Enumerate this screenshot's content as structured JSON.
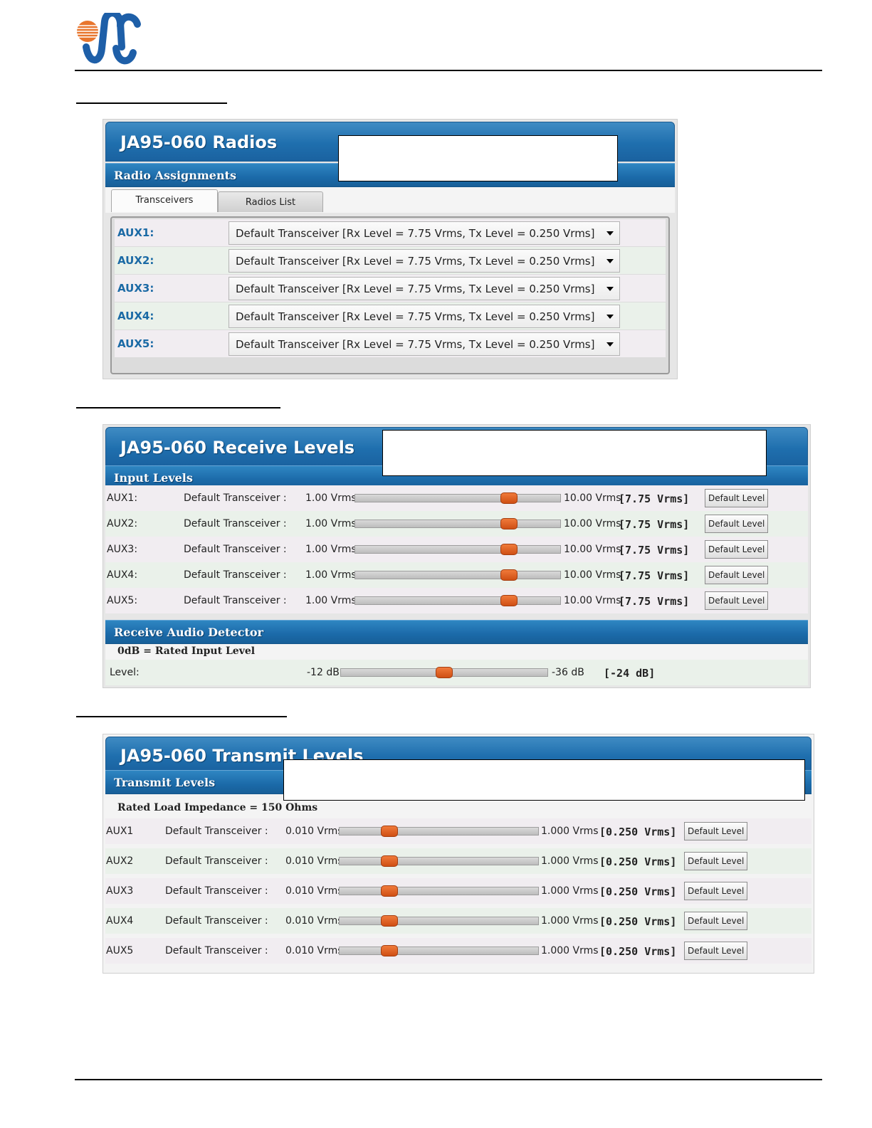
{
  "radios_panel": {
    "title": "JA95-060 Radios",
    "subtitle": "Radio Assignments",
    "tabs": [
      {
        "label": "Transceivers",
        "active": true
      },
      {
        "label": "Radios List",
        "active": false
      }
    ],
    "rows": [
      {
        "label": "AUX1:",
        "value": "Default Transceiver  [Rx Level = 7.75 Vrms,  Tx Level = 0.250 Vrms]"
      },
      {
        "label": "AUX2:",
        "value": "Default Transceiver  [Rx Level = 7.75 Vrms,  Tx Level = 0.250 Vrms]"
      },
      {
        "label": "AUX3:",
        "value": "Default Transceiver  [Rx Level = 7.75 Vrms,  Tx Level = 0.250 Vrms]"
      },
      {
        "label": "AUX4:",
        "value": "Default Transceiver  [Rx Level = 7.75 Vrms,  Tx Level = 0.250 Vrms]"
      },
      {
        "label": "AUX5:",
        "value": "Default Transceiver  [Rx Level = 7.75 Vrms,  Tx Level = 0.250 Vrms]"
      }
    ]
  },
  "receive_panel": {
    "title": "JA95-060 Receive Levels",
    "input_header": "Input Levels",
    "rows": [
      {
        "aux": "AUX1:",
        "radio": "Default Transceiver :",
        "min": "1.00 Vrms",
        "max": "10.00 Vrms",
        "current": "[7.75 Vrms]",
        "level": 0.75,
        "button": "Default Level"
      },
      {
        "aux": "AUX2:",
        "radio": "Default Transceiver :",
        "min": "1.00 Vrms",
        "max": "10.00 Vrms",
        "current": "[7.75 Vrms]",
        "level": 0.75,
        "button": "Default Level"
      },
      {
        "aux": "AUX3:",
        "radio": "Default Transceiver :",
        "min": "1.00 Vrms",
        "max": "10.00 Vrms",
        "current": "[7.75 Vrms]",
        "level": 0.75,
        "button": "Default Level"
      },
      {
        "aux": "AUX4:",
        "radio": "Default Transceiver :",
        "min": "1.00 Vrms",
        "max": "10.00 Vrms",
        "current": "[7.75 Vrms]",
        "level": 0.75,
        "button": "Default Level"
      },
      {
        "aux": "AUX5:",
        "radio": "Default Transceiver :",
        "min": "1.00 Vrms",
        "max": "10.00 Vrms",
        "current": "[7.75 Vrms]",
        "level": 0.75,
        "button": "Default Level"
      }
    ],
    "detector_header": "Receive Audio Detector",
    "detector_note": "0dB = Rated Input Level",
    "detector": {
      "label": "Level:",
      "min": "-12 dB",
      "max": "-36 dB",
      "current": "[-24 dB]",
      "level": 0.5
    }
  },
  "transmit_panel": {
    "title": "JA95-060 Transmit Levels",
    "header": "Transmit Levels",
    "note": "Rated Load Impedance = 150 Ohms",
    "rows": [
      {
        "aux": "AUX1",
        "radio": "Default Transceiver :",
        "min": "0.010 Vrms",
        "max": "1.000 Vrms",
        "current": "[0.250 Vrms]",
        "level": 0.25,
        "button": "Default Level"
      },
      {
        "aux": "AUX2",
        "radio": "Default Transceiver :",
        "min": "0.010 Vrms",
        "max": "1.000 Vrms",
        "current": "[0.250 Vrms]",
        "level": 0.25,
        "button": "Default Level"
      },
      {
        "aux": "AUX3",
        "radio": "Default Transceiver :",
        "min": "0.010 Vrms",
        "max": "1.000 Vrms",
        "current": "[0.250 Vrms]",
        "level": 0.25,
        "button": "Default Level"
      },
      {
        "aux": "AUX4",
        "radio": "Default Transceiver :",
        "min": "0.010 Vrms",
        "max": "1.000 Vrms",
        "current": "[0.250 Vrms]",
        "level": 0.25,
        "button": "Default Level"
      },
      {
        "aux": "AUX5",
        "radio": "Default Transceiver :",
        "min": "0.010 Vrms",
        "max": "1.000 Vrms",
        "current": "[0.250 Vrms]",
        "level": 0.25,
        "button": "Default Level"
      }
    ]
  },
  "colors": {
    "accent_blue": "#1f6fae",
    "slider_thumb": "#e0601f",
    "row_alt_a": "#f1edf1",
    "row_alt_b": "#eaf1ea"
  },
  "icons": {
    "logo": "company-logo-icon",
    "dropdown": "chevron-down-icon"
  }
}
